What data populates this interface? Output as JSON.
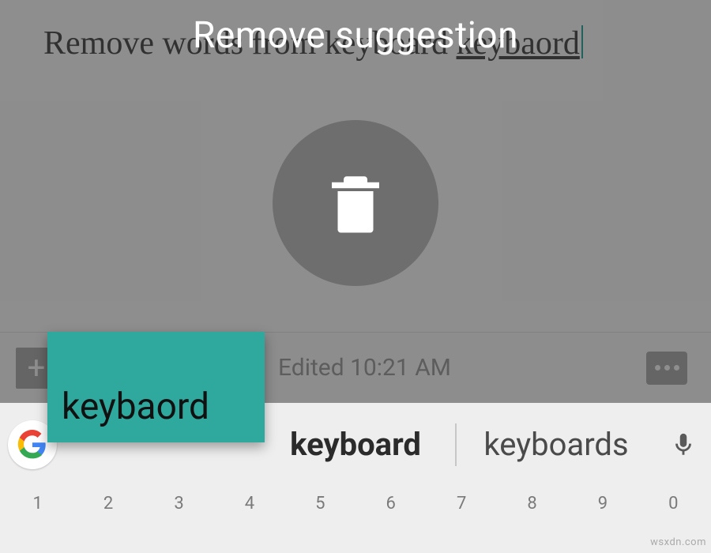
{
  "overlay": {
    "title": "Remove suggestion",
    "trash_icon": "trash-icon"
  },
  "note": {
    "text_before": "Remove words from keyboard ",
    "misspelled_word": "keybaord"
  },
  "meta": {
    "add_label": "+",
    "edited_label": "Edited 10:21 AM"
  },
  "dragged_chip": {
    "word": "keybaord"
  },
  "suggestions": {
    "slot_left": "",
    "slot_center": "keyboard",
    "slot_right": "keyboards"
  },
  "number_row": [
    "1",
    "2",
    "3",
    "4",
    "5",
    "6",
    "7",
    "8",
    "9",
    "0"
  ],
  "colors": {
    "accent": "#2fa89e",
    "overlay_dim": "rgba(60,60,60,.58)",
    "trash_bg": "#6e6e6e"
  },
  "watermark": "wsxdn.com"
}
